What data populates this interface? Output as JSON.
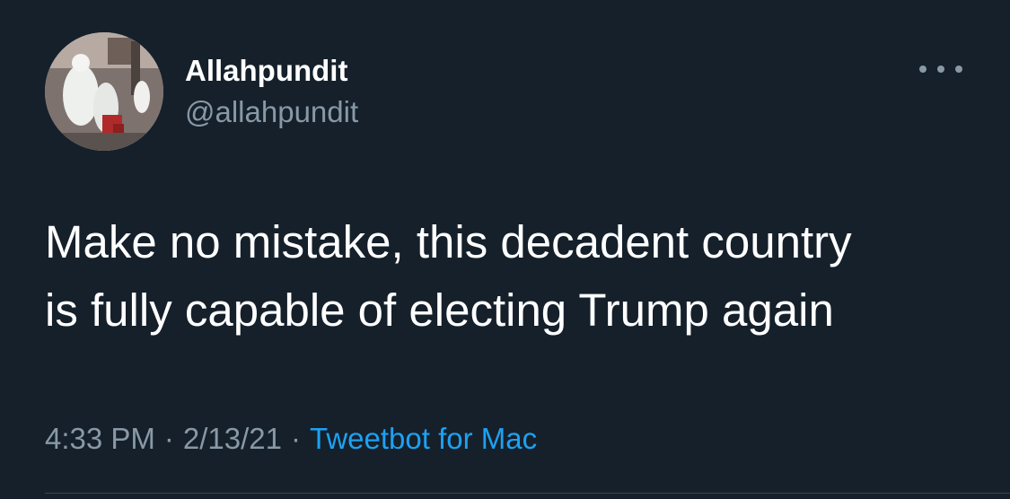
{
  "author": {
    "display_name": "Allahpundit",
    "handle": "@allahpundit"
  },
  "tweet": {
    "text_lines": [
      "Make no mistake, this decadent country",
      "is fully capable of electing Trump again"
    ],
    "time": "4:33 PM",
    "separator": "·",
    "date": "2/13/21",
    "source": "Tweetbot for Mac"
  },
  "icons": {
    "more": "more-horizontal-icon"
  },
  "colors": {
    "background": "#15202b",
    "text": "#ffffff",
    "muted": "#8899a6",
    "link": "#1da1f2"
  }
}
